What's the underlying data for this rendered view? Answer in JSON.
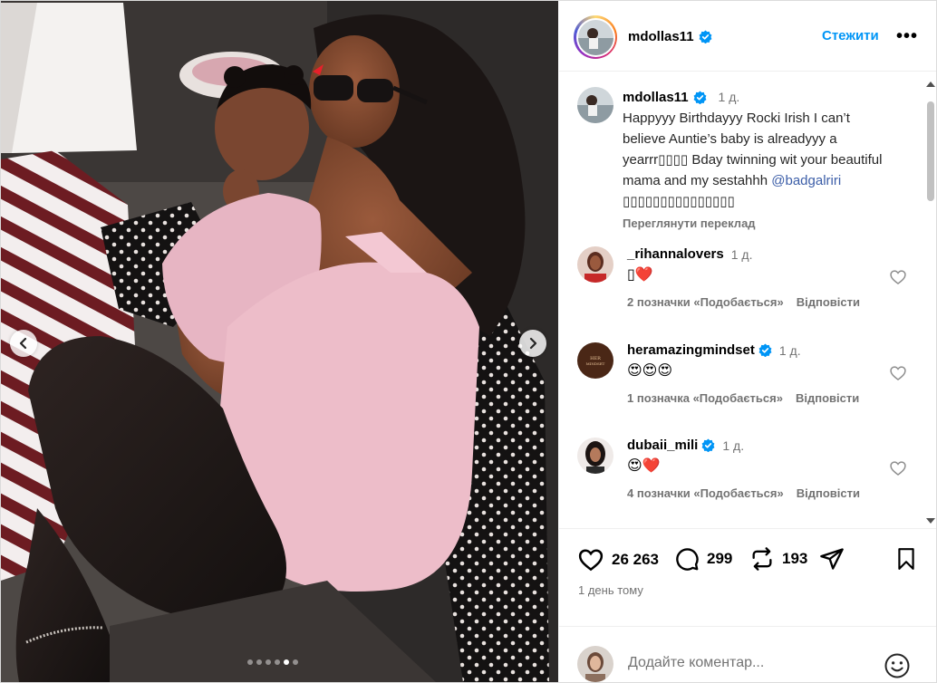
{
  "post": {
    "username": "mdollas11",
    "follow_label": "Стежити",
    "more_label": "•••",
    "caption": {
      "username": "mdollas11",
      "time": "1 д.",
      "text": "Happyyy Birthdayyy Rocki Irish I can’t believe Auntie’s baby is alreadyyy a yearrr▯▯▯▯ Bday twinning wit your beautiful mama and my sestahhh",
      "mention": "@badgalriri",
      "mention_tail": " ▯▯▯▯▯▯▯▯▯▯▯▯▯▯▯",
      "translate": "Переглянути переклад"
    },
    "comments": [
      {
        "username": "_rihannalovers",
        "time": "1 д.",
        "text": "▯❤️",
        "likes": "2 позначки «Подобається»",
        "reply": "Відповісти",
        "verified": false
      },
      {
        "username": "heramazingmindset",
        "time": "1 д.",
        "text": "😍😍😍",
        "likes": "1 позначка «Подобається»",
        "reply": "Відповісти",
        "verified": true
      },
      {
        "username": "dubaii_mili",
        "time": "1 д.",
        "text": "😍❤️",
        "likes": "4 позначки «Подобається»",
        "reply": "Відповісти",
        "verified": true
      }
    ],
    "stats": {
      "likes": "26 263",
      "comments": "299",
      "reposts": "193"
    },
    "time_ago": "1 день тому",
    "add_comment_placeholder": "Додайте коментар...",
    "carousel": {
      "count": 6,
      "active": 4
    }
  },
  "colors": {
    "accent": "#0095f6",
    "verified": "#0095f6",
    "heart": "#ed1c2f",
    "muted": "#737373"
  },
  "icons": [
    "chevron-left-icon",
    "chevron-right-icon",
    "verified-badge-icon",
    "heart-icon",
    "comment-icon",
    "repost-icon",
    "share-icon",
    "bookmark-icon",
    "emoji-icon"
  ]
}
